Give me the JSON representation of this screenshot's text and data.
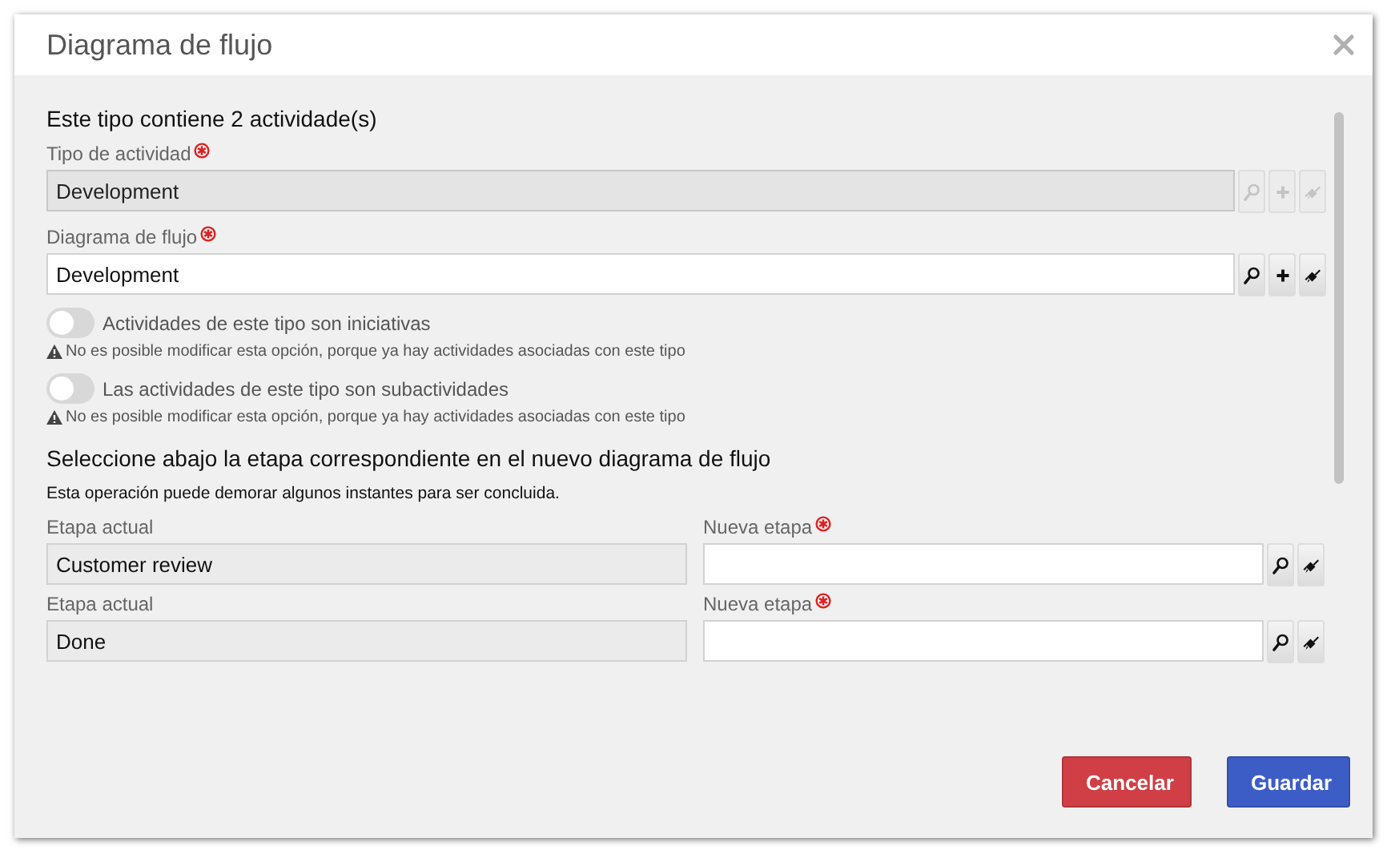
{
  "window": {
    "title": "Diagrama de flujo"
  },
  "summary": "Este tipo contiene 2 actividade(s)",
  "fields": [
    {
      "label": "Tipo de actividad",
      "required": true,
      "value": "Development",
      "disabled": true
    },
    {
      "label": "Diagrama de flujo",
      "required": true,
      "value": "Development",
      "disabled": false
    }
  ],
  "toggles": [
    {
      "label": "Actividades de este tipo son iniciativas",
      "on": false,
      "warning": "No es posible modificar esta opción, porque ya hay actividades asociadas con este tipo"
    },
    {
      "label": "Las actividades de este tipo son subactividades",
      "on": false,
      "warning": "No es posible modificar esta opción, porque ya hay actividades asociadas con este tipo"
    }
  ],
  "section": {
    "heading": "Seleccione abajo la etapa correspondiente en el nuevo diagrama de flujo",
    "note": "Esta operación puede demorar algunos instantes para ser concluida."
  },
  "stages": [
    {
      "current_label": "Etapa actual",
      "current_value": "Customer review",
      "new_label": "Nueva etapa",
      "required": true
    },
    {
      "current_label": "Etapa actual",
      "current_value": "Done",
      "new_label": "Nueva etapa",
      "required": true
    }
  ],
  "buttons": [
    {
      "label": "Cancelar",
      "kind": "cancel"
    },
    {
      "label": "Guardar",
      "kind": "save"
    }
  ]
}
